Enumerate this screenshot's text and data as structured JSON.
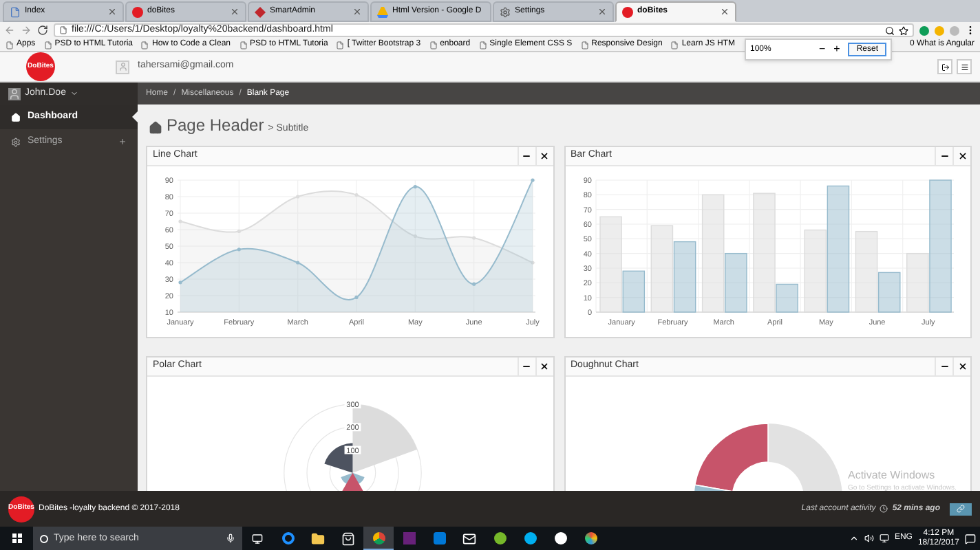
{
  "browser": {
    "tabs": [
      {
        "title": "Index",
        "kind": "page",
        "selected": false
      },
      {
        "title": "doBites",
        "kind": "dobites",
        "selected": false
      },
      {
        "title": "SmartAdmin",
        "kind": "smartadmin",
        "selected": false
      },
      {
        "title": "Html Version - Google D",
        "kind": "drive",
        "selected": false
      },
      {
        "title": "Settings",
        "kind": "gear",
        "selected": false
      },
      {
        "title": "doBites",
        "kind": "dobites",
        "selected": true
      }
    ],
    "address": "file:///C:/Users/1/Desktop/loyalty%20backend/dashboard.html",
    "bookmarks": [
      "Apps",
      "PSD to HTML Tutoria",
      "How to Code a Clean",
      "PSD to HTML Tutoria",
      "[ Twitter Bootstrap 3",
      "enboard",
      "Single Element CSS S",
      "Responsive Design",
      "Learn JS HTM"
    ],
    "bookmarks_after": [
      "0 What is Angular"
    ],
    "zoom_popup": {
      "level": "100%",
      "minus": "−",
      "plus": "+",
      "reset": "Reset"
    }
  },
  "header": {
    "logo": "DoBites",
    "email": "tahersami@gmail.com"
  },
  "sidebar": {
    "user": "John.Doe",
    "items": [
      {
        "label": "Dashboard",
        "kind": "home",
        "selected": true
      },
      {
        "label": "Settings",
        "kind": "gear",
        "selected": false
      }
    ]
  },
  "breadcrumb": {
    "separator": "/",
    "items": [
      "Home",
      "Miscellaneous",
      "Blank Page"
    ]
  },
  "page_header": {
    "title": "Page Header",
    "subtitle": "> Subtitle"
  },
  "panels": [
    {
      "title": "Line Chart",
      "kind": "line",
      "chart_data": {
        "type": "area",
        "categories": [
          "January",
          "February",
          "March",
          "April",
          "May",
          "June",
          "July"
        ],
        "ylim": [
          10,
          90
        ],
        "yticks": [
          10,
          20,
          30,
          40,
          50,
          60,
          70,
          80,
          90
        ],
        "grid": true,
        "series": [
          {
            "color": "#dcdcdc",
            "values": [
              65,
              59,
              80,
              81,
              56,
              55,
              40
            ]
          },
          {
            "color": "#97bbcd",
            "values": [
              28,
              48,
              40,
              19,
              86,
              27,
              90
            ]
          }
        ]
      }
    },
    {
      "title": "Bar Chart",
      "kind": "bar",
      "chart_data": {
        "type": "bar",
        "categories": [
          "January",
          "February",
          "March",
          "April",
          "May",
          "June",
          "July"
        ],
        "ylim": [
          0,
          90
        ],
        "yticks": [
          0,
          10,
          20,
          30,
          40,
          50,
          60,
          70,
          80,
          90
        ],
        "grid": true,
        "series": [
          {
            "color": "#dcdcdc",
            "values": [
              65,
              59,
              80,
              81,
              56,
              55,
              40
            ]
          },
          {
            "color": "#97bbcd",
            "values": [
              28,
              48,
              40,
              19,
              86,
              27,
              90
            ]
          }
        ]
      }
    },
    {
      "title": "Polar Chart",
      "kind": "polar",
      "ticks": [
        "300",
        "200",
        "100"
      ]
    },
    {
      "title": "Doughnut Chart",
      "kind": "doughnut"
    }
  ],
  "os_notice": {
    "title": "Activate Windows",
    "text": "Go to Settings to activate Windows."
  },
  "footer": {
    "logo": "DoBites",
    "text": "DoBites -loyalty backend © 2017-2018",
    "activity_label": "Last account activity",
    "activity_time": "52 mins ago"
  },
  "taskbar": {
    "search_placeholder": "Type here to search",
    "apps": [
      {
        "kind": "edge",
        "selected": false
      },
      {
        "kind": "folder",
        "selected": false
      },
      {
        "kind": "store",
        "selected": false
      },
      {
        "kind": "chrome",
        "selected": true
      },
      {
        "kind": "vs",
        "selected": false
      },
      {
        "kind": "vscode",
        "selected": false
      },
      {
        "kind": "mail",
        "selected": false
      },
      {
        "kind": "torrent",
        "selected": false
      },
      {
        "kind": "skype",
        "selected": false
      },
      {
        "kind": "clover",
        "selected": false
      },
      {
        "kind": "paint",
        "selected": false
      }
    ],
    "language": "ENG",
    "time": "4:12 PM",
    "date": "18/12/2017"
  }
}
